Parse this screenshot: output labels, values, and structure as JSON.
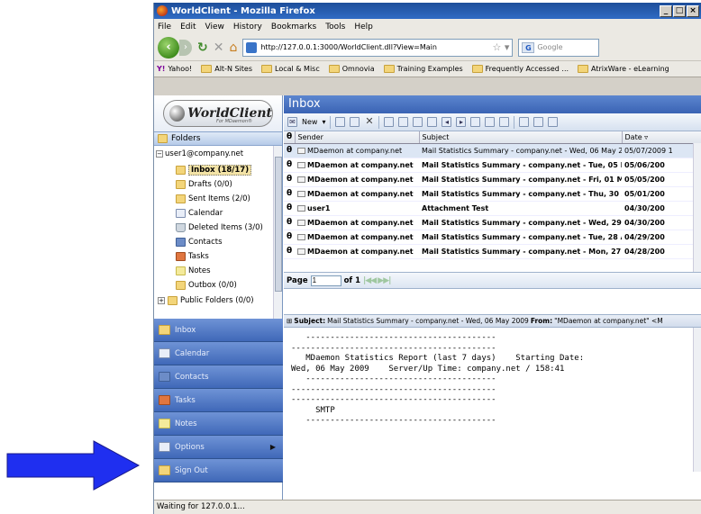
{
  "window": {
    "title": "WorldClient - Mozilla Firefox",
    "controls": [
      "_",
      "□",
      "×"
    ]
  },
  "menu": [
    "File",
    "Edit",
    "View",
    "History",
    "Bookmarks",
    "Tools",
    "Help"
  ],
  "nav": {
    "url": "http://127.0.0.1:3000/WorldClient.dll?View=Main",
    "search_placeholder": "Google"
  },
  "bookmarks": [
    "Yahoo!",
    "Alt-N Sites",
    "Local & Misc",
    "Omnovia",
    "Training Examples",
    "Frequently Accessed ...",
    "AtrixWare - eLearning"
  ],
  "logo": {
    "text": "WorldClient",
    "sub": "For MDaemon®"
  },
  "folders_pane": {
    "title": "Folders",
    "account": "user1@company.net",
    "items": [
      {
        "label": "Inbox (18/17)",
        "icon": "folder-icon"
      },
      {
        "label": "Drafts (0/0)",
        "icon": "folder-icon"
      },
      {
        "label": "Sent Items (2/0)",
        "icon": "folder-icon"
      },
      {
        "label": "Calendar",
        "icon": "calendar-icon"
      },
      {
        "label": "Deleted Items (3/0)",
        "icon": "trash-icon"
      },
      {
        "label": "Contacts",
        "icon": "contacts-icon"
      },
      {
        "label": "Tasks",
        "icon": "tasks-icon"
      },
      {
        "label": "Notes",
        "icon": "notes-icon"
      },
      {
        "label": "Outbox (0/0)",
        "icon": "folder-icon"
      },
      {
        "label": "Public Folders (0/0)",
        "icon": "folder-icon"
      }
    ]
  },
  "nav_buttons": [
    "Inbox",
    "Calendar",
    "Contacts",
    "Tasks",
    "Notes",
    "Options",
    "Sign Out"
  ],
  "inbox": {
    "title": "Inbox",
    "new_label": "New",
    "columns": [
      "Sender",
      "Subject",
      "Date"
    ],
    "rows": [
      {
        "sender": "MDaemon at company.net",
        "subject": "Mail Statistics Summary - company.net - Wed, 06 May 2009",
        "date": "05/07/2009 1",
        "bold": false
      },
      {
        "sender": "MDaemon at company.net",
        "subject": "Mail Statistics Summary - company.net - Tue, 05 Ma",
        "date": "05/06/200",
        "bold": true
      },
      {
        "sender": "MDaemon at company.net",
        "subject": "Mail Statistics Summary - company.net - Fri, 01 May",
        "date": "05/05/200",
        "bold": true
      },
      {
        "sender": "MDaemon at company.net",
        "subject": "Mail Statistics Summary - company.net - Thu, 30 Ap",
        "date": "05/01/200",
        "bold": true
      },
      {
        "sender": "user1",
        "subject": "Attachment Test",
        "date": "04/30/200",
        "bold": true
      },
      {
        "sender": "MDaemon at company.net",
        "subject": "Mail Statistics Summary - company.net - Wed, 29 A",
        "date": "04/30/200",
        "bold": true
      },
      {
        "sender": "MDaemon at company.net",
        "subject": "Mail Statistics Summary - company.net - Tue, 28 Ap",
        "date": "04/29/200",
        "bold": true
      },
      {
        "sender": "MDaemon at company.net",
        "subject": "Mail Statistics Summary - company.net - Mon, 27 Ap",
        "date": "04/28/200",
        "bold": true
      }
    ]
  },
  "pager": {
    "page_label": "Page",
    "page_value": "1",
    "of_label": "of 1"
  },
  "preview": {
    "subject_label": "Subject:",
    "subject": "Mail Statistics Summary - company.net - Wed, 06 May 2009",
    "from_label": "From:",
    "from": "\"MDaemon at company.net\" <M",
    "lines": [
      "   ---------------------------------------",
      "------------------------------------------",
      "   MDaemon Statistics Report (last 7 days)    Starting Date:",
      "Wed, 06 May 2009    Server/Up Time: company.net / 158:41",
      "   ---------------------------------------",
      "------------------------------------------",
      "------------------------------------------",
      "",
      "",
      "     SMTP",
      "",
      "   ---------------------------------------"
    ]
  },
  "status": "Waiting for 127.0.0.1...",
  "colors": {
    "arrow": "#1f2ff0",
    "nav_button": "#4a73c2",
    "title_bar": "#2a5fb8"
  }
}
